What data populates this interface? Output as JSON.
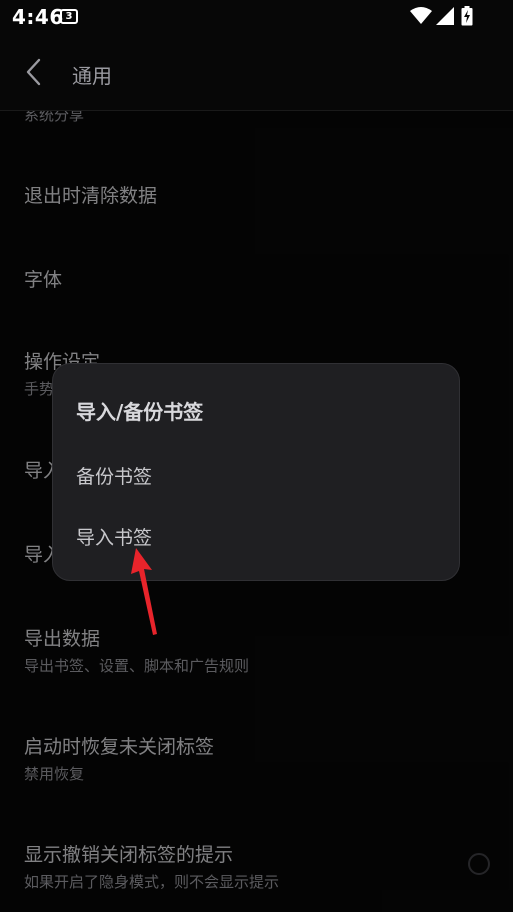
{
  "status_bar": {
    "time": "4:46",
    "notification_badge": "3"
  },
  "app_bar": {
    "title": "通用",
    "back_icon": "chevron-left-icon"
  },
  "settings": {
    "partial_top_subtitle": "系统分享",
    "clear_data": {
      "title": "退出时清除数据"
    },
    "font": {
      "title": "字体"
    },
    "operation": {
      "title": "操作设定",
      "subtitle_partial": "手势"
    },
    "import_partial_1": {
      "title_partial": "导入"
    },
    "import_partial_2": {
      "title_partial": "导入"
    },
    "export": {
      "title": "导出数据",
      "subtitle": "导出书签、设置、脚本和广告规则"
    },
    "restore_tabs": {
      "title": "启动时恢复未关闭标签",
      "subtitle": "禁用恢复"
    },
    "undo_close_hint": {
      "title": "显示撤销关闭标签的提示",
      "subtitle": "如果开启了隐身模式，则不会显示提示"
    }
  },
  "dialog": {
    "title": "导入/备份书签",
    "options": [
      "备份书签",
      "导入书签"
    ]
  },
  "colors": {
    "background": "#070707",
    "dialog": "#1f1f22",
    "arrow": "#e8242b"
  }
}
